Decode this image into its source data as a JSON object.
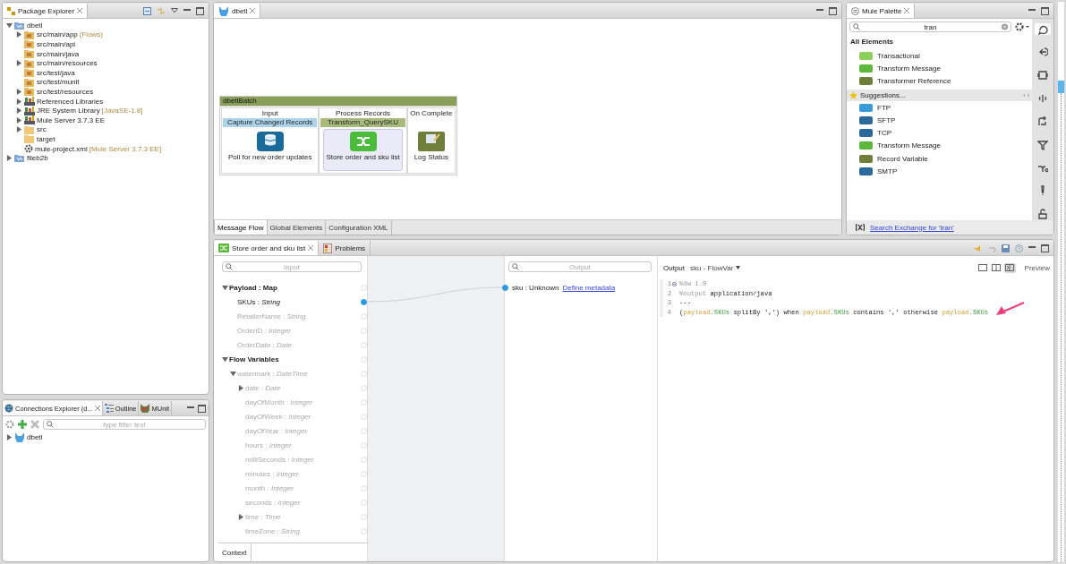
{
  "package_explorer": {
    "tab": "Package Explorer",
    "tree": [
      {
        "label": "dbetl",
        "kind": "project",
        "expanded": true,
        "children": [
          {
            "label": "src/main/app",
            "decoration": "(Flows)",
            "kind": "source-folder",
            "expanded": false
          },
          {
            "label": "src/main/api",
            "kind": "source-folder"
          },
          {
            "label": "src/main/java",
            "kind": "source-folder"
          },
          {
            "label": "src/main/resources",
            "kind": "source-folder",
            "expanded": false
          },
          {
            "label": "src/test/java",
            "kind": "source-folder"
          },
          {
            "label": "src/test/munit",
            "kind": "source-folder"
          },
          {
            "label": "src/test/resources",
            "kind": "source-folder",
            "expanded": false
          },
          {
            "label": "Referenced Libraries",
            "kind": "library",
            "expanded": false
          },
          {
            "label": "JRE System Library",
            "decoration": "[JavaSE-1.8]",
            "kind": "library",
            "expanded": false
          },
          {
            "label": "Mule Server 3.7.3 EE",
            "kind": "library",
            "expanded": false
          },
          {
            "label": "src",
            "kind": "folder",
            "expanded": false
          },
          {
            "label": "target",
            "kind": "folder"
          },
          {
            "label": "mule-project.xml",
            "decoration": "[Mule Server 3.7.3 EE]",
            "kind": "file"
          }
        ]
      },
      {
        "label": "fileb2b",
        "kind": "project",
        "expanded": false
      }
    ]
  },
  "connections_explorer": {
    "tabs": [
      {
        "label": "Connections Explorer (d...",
        "kind": "connections",
        "selected": true
      },
      {
        "label": "Outline",
        "kind": "outline",
        "selected": false
      },
      {
        "label": "MUnit",
        "kind": "munit",
        "selected": false
      }
    ],
    "filter": {
      "placeholder": "type filter text"
    },
    "tree": [
      {
        "label": "dbetl",
        "kind": "mule",
        "expanded": false
      }
    ]
  },
  "flow_editor": {
    "tab": "dbetl",
    "batch": {
      "title": "dbetlBatch",
      "phases": [
        {
          "title": "Input",
          "header": "Capture Changed Records",
          "kind": "source",
          "component": {
            "kind": "database",
            "label": "Poll for new order updates",
            "selected": false
          }
        },
        {
          "title": "Process Records",
          "header": "Transform_QuerySKU",
          "kind": "step",
          "component": {
            "kind": "transform",
            "label": "Store order and sku list",
            "selected": true
          }
        },
        {
          "title": "On Complete",
          "kind": "complete",
          "component": {
            "kind": "logger",
            "label": "Log Status",
            "selected": false
          }
        }
      ]
    },
    "bottom_tabs": [
      {
        "label": "Message Flow",
        "selected": true
      },
      {
        "label": "Global Elements",
        "selected": false
      },
      {
        "label": "Configuration XML",
        "selected": false
      }
    ]
  },
  "palette": {
    "tab": "Mule Palette",
    "search": {
      "value": "tran"
    },
    "sections": [
      {
        "title": "All Elements",
        "kind": "plain",
        "items": [
          {
            "label": "Transactional",
            "kind": "transactional"
          },
          {
            "label": "Transform Message",
            "kind": "transform"
          },
          {
            "label": "Transformer Reference",
            "kind": "reference"
          }
        ]
      },
      {
        "title": "Suggestions...",
        "kind": "starred",
        "items": [
          {
            "label": "FTP",
            "kind": "ftp"
          },
          {
            "label": "SFTP",
            "kind": "sftp"
          },
          {
            "label": "TCP",
            "kind": "tcp"
          },
          {
            "label": "Transform Message",
            "kind": "transform"
          },
          {
            "label": "Record Variable",
            "kind": "variable"
          },
          {
            "label": "SMTP",
            "kind": "smtp"
          }
        ]
      }
    ],
    "toolbar": [
      {
        "kind": "search",
        "selected": true
      },
      {
        "kind": "source",
        "selected": false
      },
      {
        "kind": "scope",
        "selected": false
      },
      {
        "kind": "component",
        "selected": false
      },
      {
        "kind": "transformer",
        "selected": false
      },
      {
        "kind": "filter",
        "selected": false
      },
      {
        "kind": "router",
        "selected": false
      },
      {
        "kind": "error",
        "selected": false
      },
      {
        "kind": "security",
        "selected": false
      }
    ],
    "exchange_link": "Search Exchange for 'tran'"
  },
  "transform": {
    "tabs": [
      {
        "label": "Store order and sku list",
        "kind": "transform",
        "selected": true
      },
      {
        "label": "Problems",
        "kind": "problems",
        "selected": false
      }
    ],
    "input": {
      "placeholder": "Input",
      "context_tab": "Context",
      "tree": [
        {
          "text": "Payload : Map",
          "kind": "group",
          "mapped": false,
          "expanded": true,
          "children": [
            {
              "text": "SKUs : *String*",
              "kind": "field",
              "mapped": true
            },
            {
              "text": "RetailerName : *String*",
              "kind": "field",
              "mapped": false
            },
            {
              "text": "OrderID : *Integer*",
              "kind": "field",
              "mapped": false
            },
            {
              "text": "OrderDate : *Date*",
              "kind": "field",
              "mapped": false
            }
          ]
        },
        {
          "text": "Flow Variables",
          "kind": "group",
          "mapped": false,
          "expanded": true,
          "children": [
            {
              "text": "watermark : *DateTime*",
              "kind": "field",
              "mapped": false,
              "expanded": true,
              "children": [
                {
                  "text": "date : *Date*",
                  "kind": "field",
                  "mapped": false,
                  "expanded": false
                },
                {
                  "text": "dayOfMonth : *Integer*",
                  "kind": "field",
                  "mapped": false
                },
                {
                  "text": "dayOfWeek : *Integer*",
                  "kind": "field",
                  "mapped": false
                },
                {
                  "text": "dayOfYear : *Integer*",
                  "kind": "field",
                  "mapped": false
                },
                {
                  "text": "hours : *Integer*",
                  "kind": "field",
                  "mapped": false
                },
                {
                  "text": "milliSeconds : *Integer*",
                  "kind": "field",
                  "mapped": false
                },
                {
                  "text": "minutes : *Integer*",
                  "kind": "field",
                  "mapped": false
                },
                {
                  "text": "month : *Integer*",
                  "kind": "field",
                  "mapped": false
                },
                {
                  "text": "seconds : *Integer*",
                  "kind": "field",
                  "mapped": false
                },
                {
                  "text": "time : *Time*",
                  "kind": "field",
                  "mapped": false,
                  "expanded": false
                },
                {
                  "text": "timeZone : *String*",
                  "kind": "field",
                  "mapped": false
                }
              ]
            }
          ]
        }
      ]
    },
    "output": {
      "placeholder": "Output",
      "fields": [
        {
          "text": "sku : Unknown",
          "link": "Define metadata",
          "mapped": true
        }
      ]
    },
    "code": {
      "label": "Output",
      "target": "sku - FlowVar",
      "preview": "Preview",
      "views": [
        {
          "kind": "single",
          "selected": false
        },
        {
          "kind": "split",
          "selected": false
        },
        {
          "kind": "source",
          "selected": true
        }
      ],
      "lines": [
        {
          "number": "1",
          "foldable": true,
          "tokens": [
            {
              "text": "%dw 1.0",
              "kind": "directive"
            }
          ]
        },
        {
          "number": "2",
          "foldable": false,
          "tokens": [
            {
              "text": "%output",
              "kind": "directive"
            },
            {
              "text": " application/java",
              "kind": "plain"
            }
          ]
        },
        {
          "number": "3",
          "foldable": false,
          "tokens": [
            {
              "text": "---",
              "kind": "plain"
            }
          ]
        },
        {
          "number": "4",
          "foldable": false,
          "tokens": [
            {
              "text": "(",
              "kind": "plain"
            },
            {
              "text": "payload",
              "kind": "var"
            },
            {
              "text": ".SKUs",
              "kind": "member"
            },
            {
              "text": " splitBy ',') when ",
              "kind": "plain"
            },
            {
              "text": "payload",
              "kind": "var"
            },
            {
              "text": ".SKUs",
              "kind": "member"
            },
            {
              "text": " contains ',' otherwise ",
              "kind": "plain"
            },
            {
              "text": "payload",
              "kind": "var"
            },
            {
              "text": ".SKUs",
              "kind": "member"
            }
          ]
        }
      ]
    }
  }
}
